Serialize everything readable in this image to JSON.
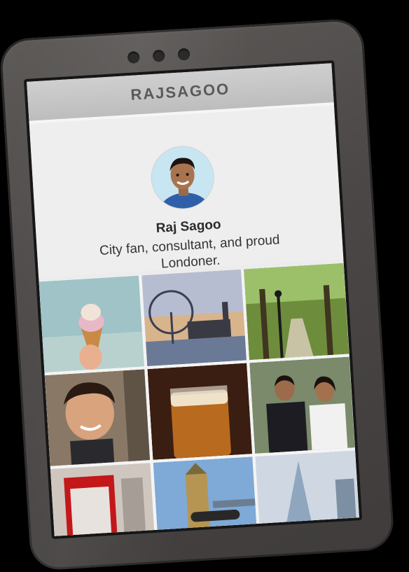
{
  "app": {
    "title": "RAJSAGOO"
  },
  "profile": {
    "name": "Raj Sagoo",
    "bio": "City fan, consultant, and proud Londoner."
  },
  "colors": {
    "phone_body": "#4a4746",
    "screen_bg": "#ececec",
    "topbar_bg": "#c6c6c6",
    "title_text": "#5a5a5a"
  },
  "photos": [
    {
      "name": "ice-cream-photo"
    },
    {
      "name": "london-eye-photo"
    },
    {
      "name": "park-avenue-photo"
    },
    {
      "name": "child-portrait-photo"
    },
    {
      "name": "beer-glass-photo"
    },
    {
      "name": "couple-photo"
    },
    {
      "name": "red-telephone-box-photo"
    },
    {
      "name": "tower-bridge-photo"
    },
    {
      "name": "shard-building-photo"
    }
  ]
}
